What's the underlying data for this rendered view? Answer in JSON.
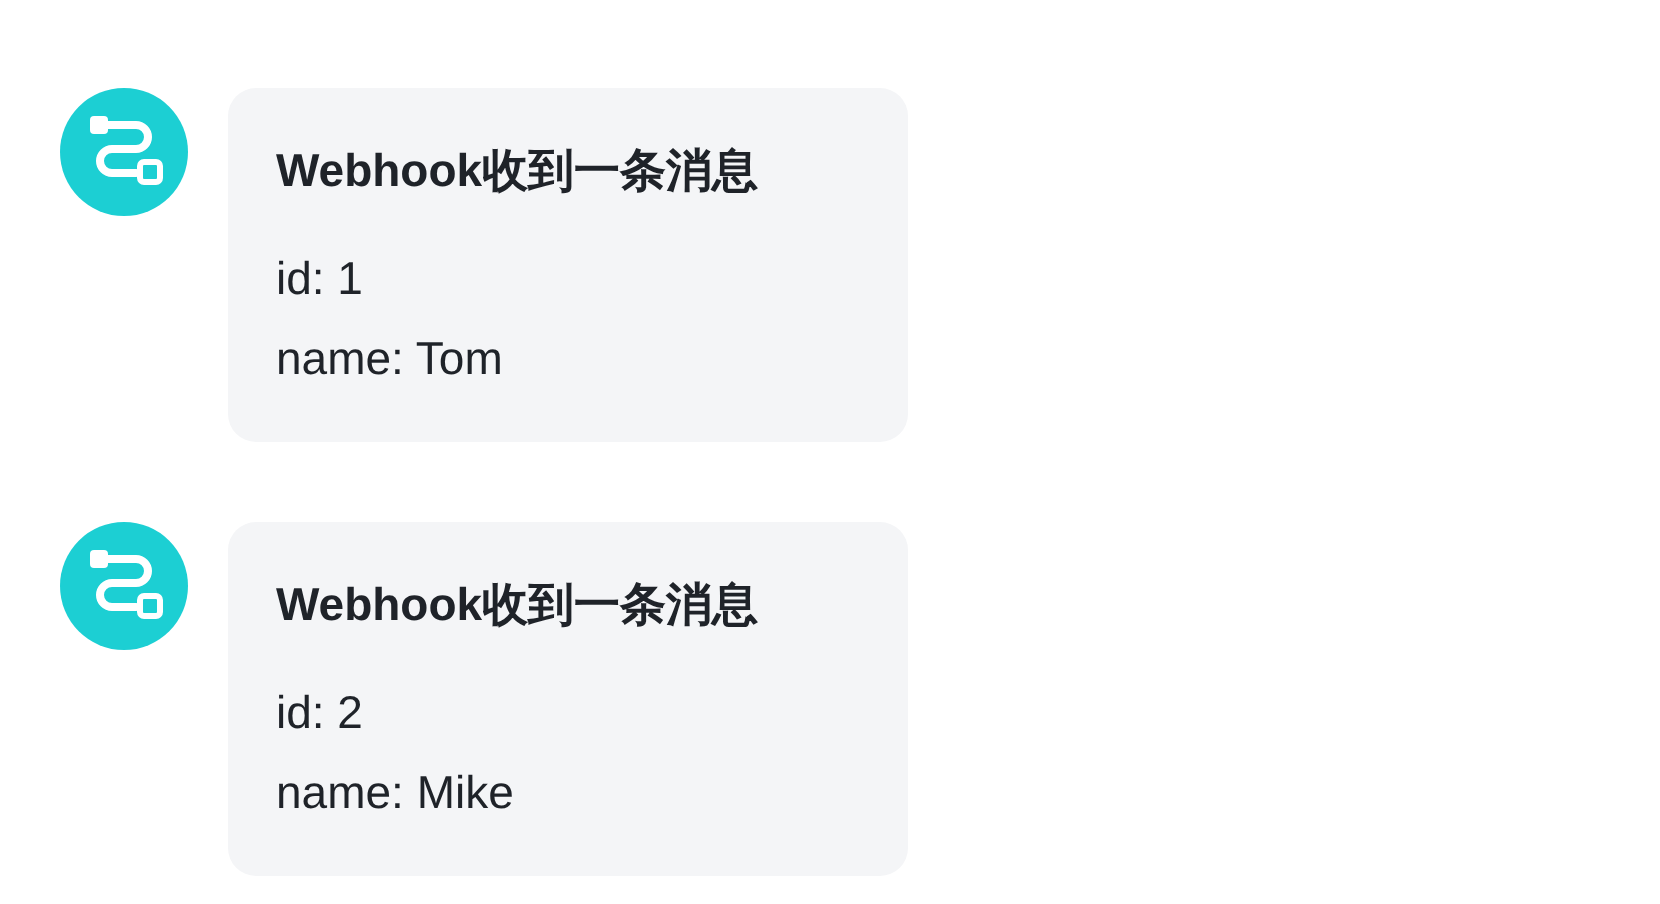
{
  "messages": [
    {
      "title": "Webhook收到一条消息",
      "lines": [
        "id: 1",
        "name: Tom"
      ]
    },
    {
      "title": "Webhook收到一条消息",
      "lines": [
        "id: 2",
        "name: Mike"
      ]
    }
  ]
}
